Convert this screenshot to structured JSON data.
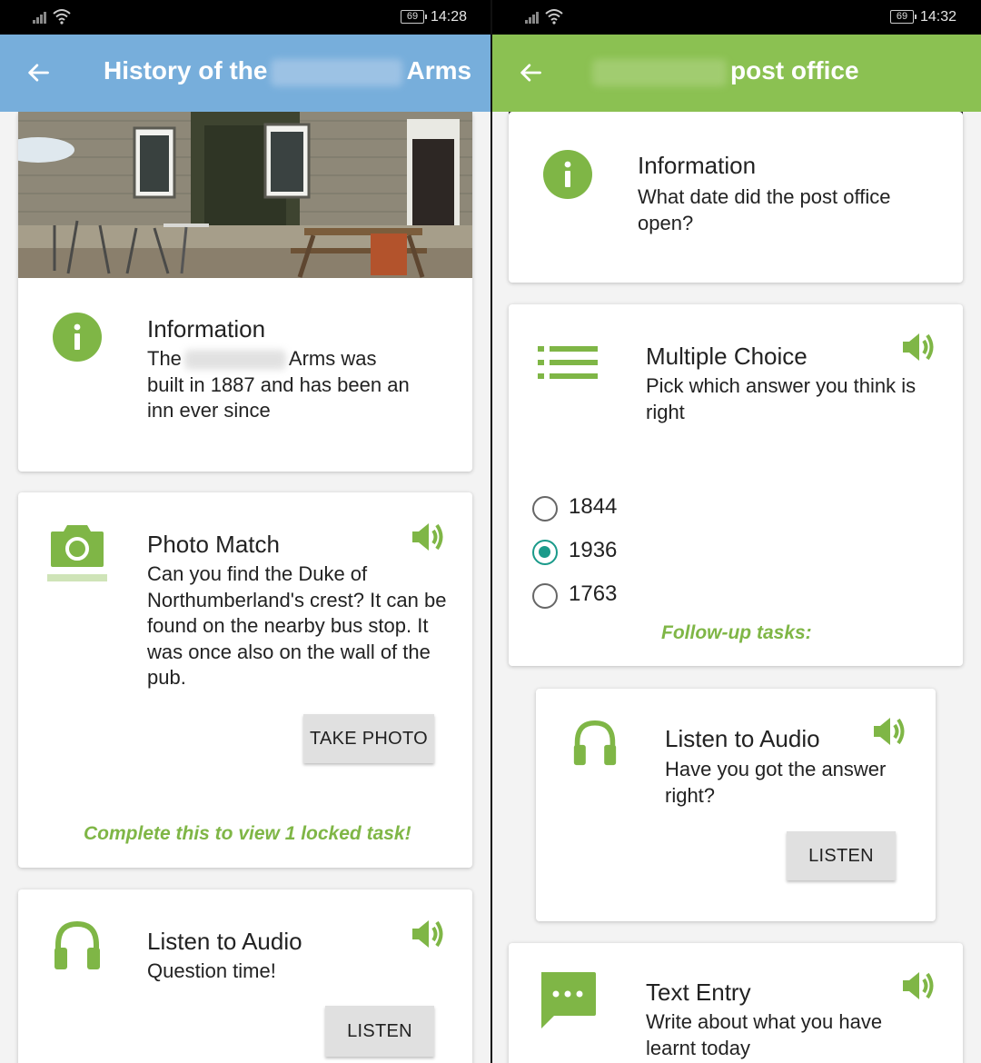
{
  "colors": {
    "accent_green": "#7fb646",
    "left_appbar": "#77aedb",
    "right_appbar": "#8bc152",
    "radio_selected": "#1a9a8a"
  },
  "left": {
    "status": {
      "battery": "69",
      "time": "14:28"
    },
    "title_prefix": "History of the",
    "title_suffix": "Arms",
    "info_card": {
      "icon": "info-icon",
      "heading": "Information",
      "body_start": "The",
      "body_rest": "Arms was",
      "body_line2": "built in 1887 and has been an",
      "body_line3": "inn ever since"
    },
    "photo_card": {
      "icon": "camera-icon",
      "heading": "Photo Match",
      "body": "Can you find the Duke of Northumberland's crest? It can be found on the nearby bus stop. It was once also on the wall of the pub.",
      "button": "TAKE PHOTO",
      "note": "Complete this to view 1 locked task!"
    },
    "audio_card": {
      "icon": "headphones-icon",
      "heading": "Listen to Audio",
      "body": "Question time!",
      "button": "LISTEN"
    }
  },
  "right": {
    "status": {
      "battery": "69",
      "time": "14:32"
    },
    "title_suffix": "post office",
    "info_card": {
      "icon": "info-icon",
      "heading": "Information",
      "body": "What date did the post office open?"
    },
    "mc_card": {
      "icon": "list-icon",
      "heading": "Multiple Choice",
      "body": "Pick which answer you think is right",
      "options": [
        "1844",
        "1936",
        "1763"
      ],
      "selected": "1936",
      "note": "Follow-up tasks:"
    },
    "audio_card": {
      "icon": "headphones-icon",
      "heading": "Listen to Audio",
      "body": "Have you got the answer right?",
      "button": "LISTEN"
    },
    "text_card": {
      "icon": "chat-icon",
      "heading": "Text Entry",
      "body": "Write about what you have learnt today"
    }
  }
}
